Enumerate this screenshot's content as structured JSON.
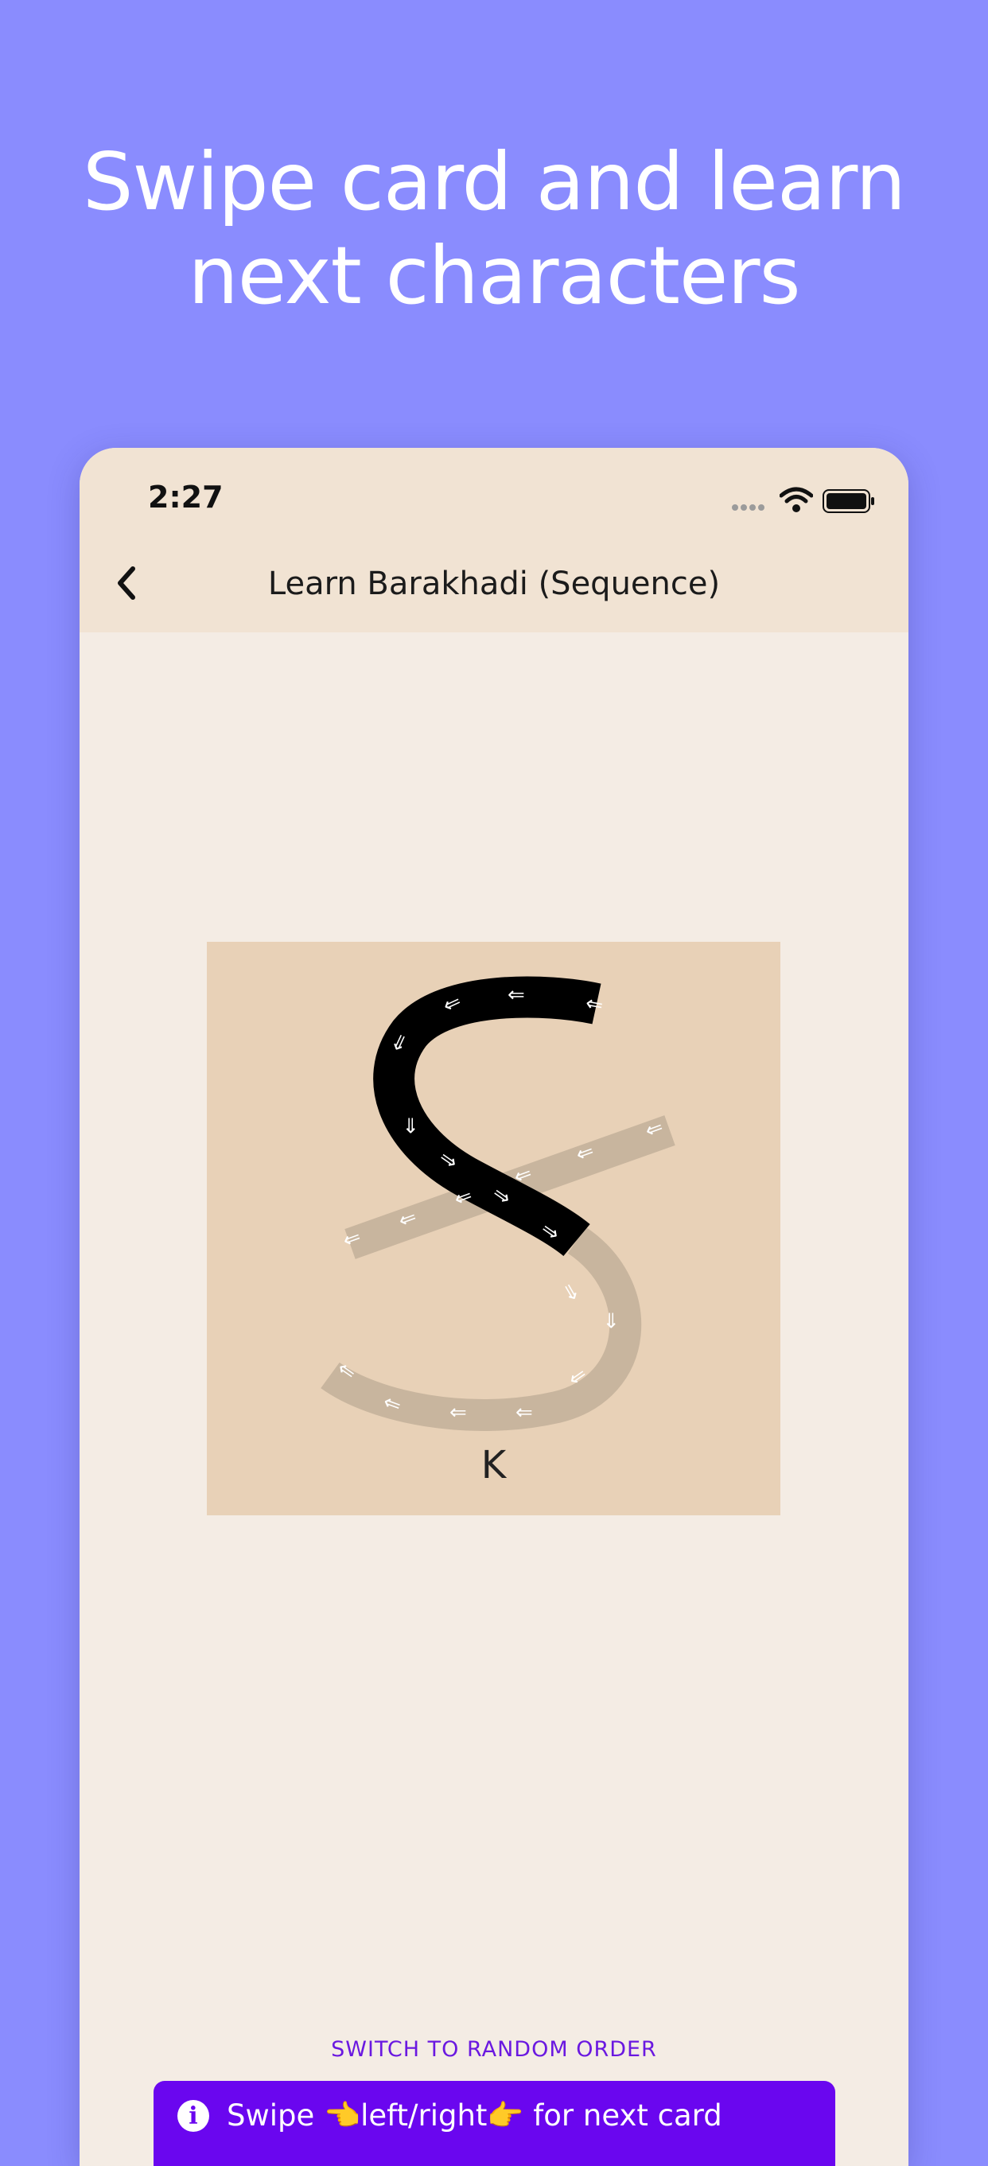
{
  "headline": {
    "line1": "Swipe card and learn",
    "line2": "next characters"
  },
  "status_bar": {
    "time": "2:27"
  },
  "nav": {
    "back_icon": "chevron-left-icon",
    "title": "Learn Barakhadi (Sequence)"
  },
  "card": {
    "label": "K",
    "arrow_glyph": "⇐"
  },
  "switch_order": {
    "label": "SWITCH TO RANDOM ORDER"
  },
  "toast": {
    "icon": "info-icon",
    "message": "Swipe 👈left/right👉 for next card"
  },
  "colors": {
    "background": "#8a8cfe",
    "topbar": "#f1e3d3",
    "screen": "#f4ece4",
    "card": "#e8d1b7",
    "stroke_done": "#000000",
    "stroke_pending": "#c8b59e",
    "accent": "#6a06ef"
  }
}
